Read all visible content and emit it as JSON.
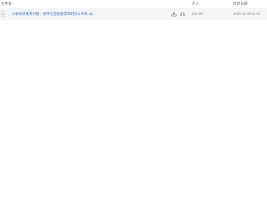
{
  "header": {
    "name_label": "文件名",
    "sort_glyph": "↑",
    "size_label": "大小",
    "date_label": "修改日期"
  },
  "files": [
    {
      "name": "公安局进展系列图：依序已签配股票等相对公共局.zip",
      "size": "251.6M",
      "date": "2025-11-08 21:01"
    }
  ],
  "icons": {
    "file": "zip-file-icon",
    "download": "download-icon",
    "share": "share-icon"
  },
  "colors": {
    "link": "#3e6fd1",
    "row_bg": "#f5f6f8",
    "muted": "#888888"
  }
}
